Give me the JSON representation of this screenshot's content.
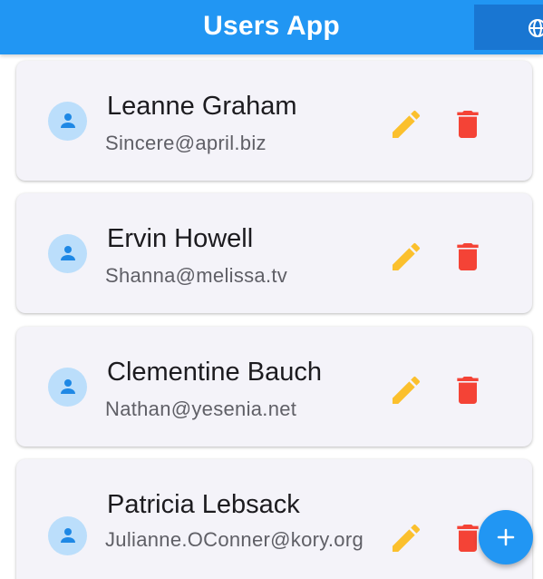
{
  "app": {
    "title": "Users App"
  },
  "header": {
    "language_icon": "globe-icon"
  },
  "users": [
    {
      "name": "Leanne Graham",
      "email": "Sincere@april.biz"
    },
    {
      "name": "Ervin Howell",
      "email": "Shanna@melissa.tv"
    },
    {
      "name": "Clementine Bauch",
      "email": "Nathan@yesenia.net"
    },
    {
      "name": "Patricia Lebsack",
      "email": "Julianne.OConner@kory.org"
    }
  ],
  "icons": {
    "avatar": "person-icon",
    "edit": "pencil-icon",
    "delete": "trash-icon",
    "add": "plus-icon"
  },
  "colors": {
    "primary": "#2196f3",
    "primary_dark": "#1976d2",
    "card_background": "#f4f3f9",
    "avatar_background": "#bbdefb",
    "avatar_icon": "#1e88e5",
    "edit_icon": "#fbc02d",
    "delete_icon": "#f44336"
  }
}
